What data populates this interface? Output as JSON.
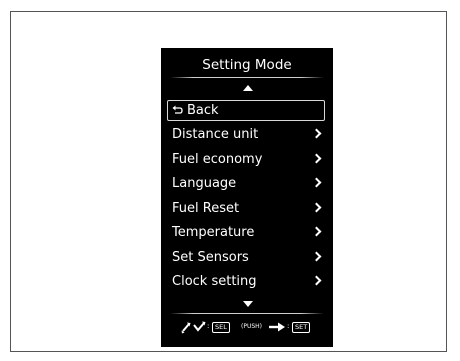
{
  "screen": {
    "title": "Setting Mode",
    "menu_items": [
      {
        "label": "Back",
        "icon": "return-arrow-icon",
        "selected": true
      },
      {
        "label": "Distance unit",
        "icon": "chevron-right-icon"
      },
      {
        "label": "Fuel economy",
        "icon": "chevron-right-icon"
      },
      {
        "label": "Language",
        "icon": "chevron-right-icon"
      },
      {
        "label": "Fuel Reset",
        "icon": "chevron-right-icon"
      },
      {
        "label": "Temperature",
        "icon": "chevron-right-icon"
      },
      {
        "label": "Set Sensors",
        "icon": "chevron-right-icon"
      },
      {
        "label": "Clock setting",
        "icon": "chevron-right-icon"
      }
    ],
    "controls": {
      "sel_colon": ":",
      "sel_label": "SEL",
      "push_text": "(PUSH)",
      "set_colon": ":",
      "set_label": "SET"
    }
  },
  "colors": {
    "screen_bg": "#000000",
    "text": "#ffffff",
    "selection_border": "#d8d8d8"
  }
}
